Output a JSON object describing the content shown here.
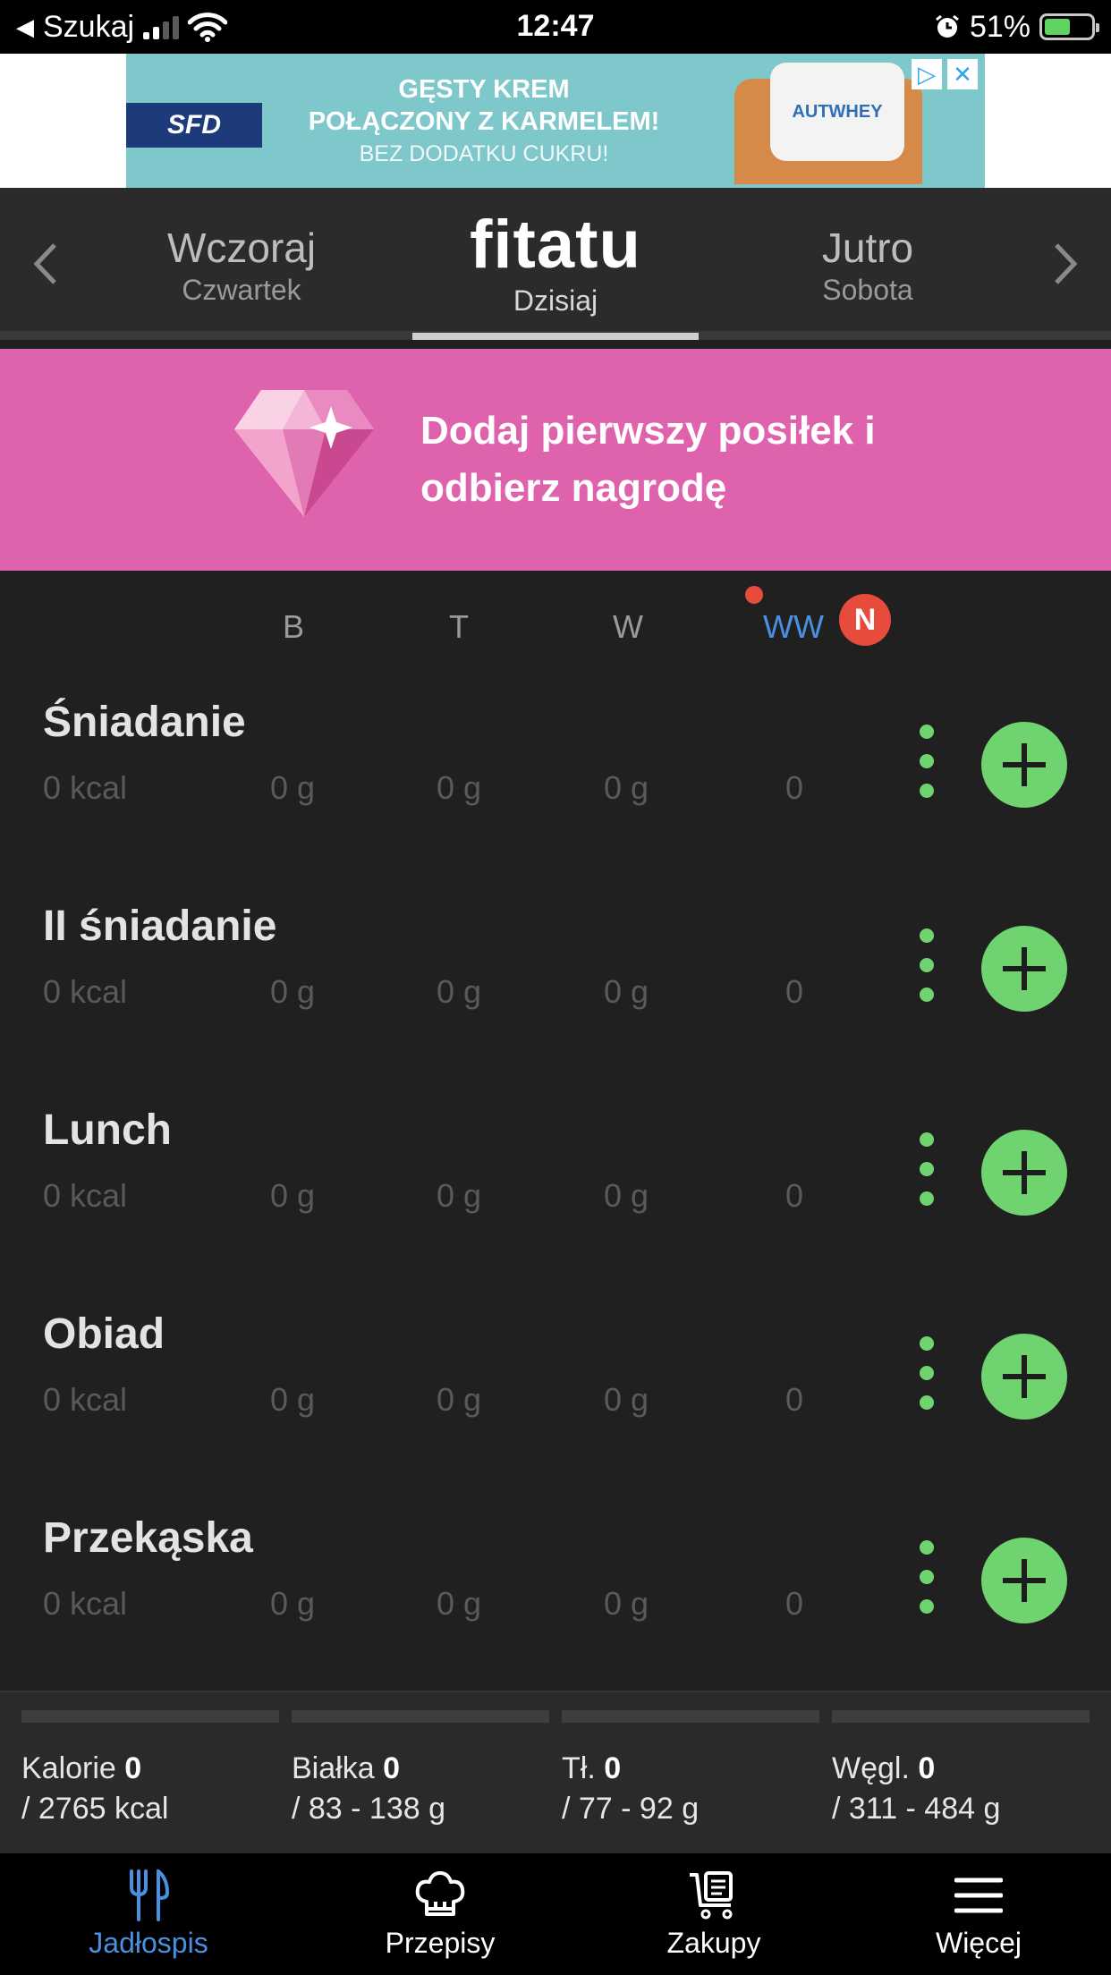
{
  "status_bar": {
    "back_label": "Szukaj",
    "time": "12:47",
    "battery_percent": "51%"
  },
  "ad": {
    "logo": "SFD",
    "line1": "GĘSTY KREM",
    "line2": "POŁĄCZONY Z KARMELEM!",
    "line3": "BEZ DODATKU CUKRU!",
    "product": "AUTWHEY"
  },
  "day_nav": {
    "prev_day": "Wczoraj",
    "prev_weekday": "Czwartek",
    "app_name": "fitatu",
    "current_day": "Dzisiaj",
    "next_day": "Jutro",
    "next_weekday": "Sobota"
  },
  "promo": {
    "text": "Dodaj pierwszy posiłek i odbierz nagrodę"
  },
  "columns": {
    "b": "B",
    "t": "T",
    "w": "W",
    "ww": "WW",
    "new_badge": "N"
  },
  "meals": [
    {
      "name": "Śniadanie",
      "kcal": "0 kcal",
      "b": "0 g",
      "t": "0 g",
      "w": "0 g",
      "ww": "0"
    },
    {
      "name": "II śniadanie",
      "kcal": "0 kcal",
      "b": "0 g",
      "t": "0 g",
      "w": "0 g",
      "ww": "0"
    },
    {
      "name": "Lunch",
      "kcal": "0 kcal",
      "b": "0 g",
      "t": "0 g",
      "w": "0 g",
      "ww": "0"
    },
    {
      "name": "Obiad",
      "kcal": "0 kcal",
      "b": "0 g",
      "t": "0 g",
      "w": "0 g",
      "ww": "0"
    },
    {
      "name": "Przekąska",
      "kcal": "0 kcal",
      "b": "0 g",
      "t": "0 g",
      "w": "0 g",
      "ww": "0"
    }
  ],
  "summary": [
    {
      "label": "Kalorie",
      "value": "0",
      "range": "/ 2765 kcal"
    },
    {
      "label": "Białka",
      "value": "0",
      "range": "/ 83 - 138 g"
    },
    {
      "label": "Tł.",
      "value": "0",
      "range": "/ 77 - 92 g"
    },
    {
      "label": "Węgl.",
      "value": "0",
      "range": "/ 311 - 484 g"
    }
  ],
  "tabs": [
    {
      "label": "Jadłospis",
      "icon": "fork-knife-icon"
    },
    {
      "label": "Przepisy",
      "icon": "chef-hat-icon"
    },
    {
      "label": "Zakupy",
      "icon": "cart-icon"
    },
    {
      "label": "Więcej",
      "icon": "menu-icon"
    }
  ],
  "colors": {
    "accent_green": "#6fd36f",
    "promo_pink": "#df62ad",
    "active_blue": "#4a90e2",
    "badge_red": "#e64b3c"
  }
}
